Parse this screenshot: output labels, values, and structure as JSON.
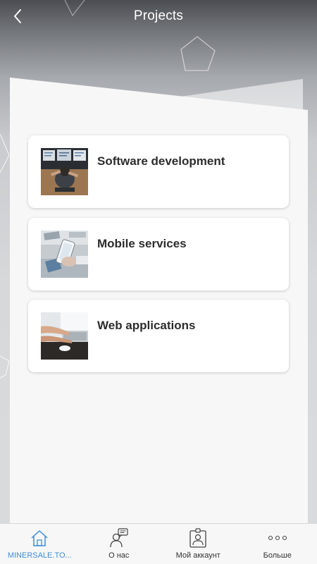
{
  "header": {
    "title": "Projects",
    "back_icon": "chevron-left-icon"
  },
  "projects": [
    {
      "title": "Software development",
      "thumb_icon": "developer-desk-photo"
    },
    {
      "title": "Mobile services",
      "thumb_icon": "smartphone-photo"
    },
    {
      "title": "Web applications",
      "thumb_icon": "laptop-typing-photo"
    }
  ],
  "tabbar": {
    "tabs": [
      {
        "label": "MINERSALE.TO...",
        "icon": "home-icon",
        "active": true
      },
      {
        "label": "О нас",
        "icon": "person-chat-icon",
        "active": false
      },
      {
        "label": "Мой аккаунт",
        "icon": "account-badge-icon",
        "active": false
      },
      {
        "label": "Больше",
        "icon": "more-dots-icon",
        "active": false
      }
    ]
  },
  "colors": {
    "accent": "#3d8ed9",
    "card_title": "#2d2d2d",
    "header_text": "#ffffff"
  }
}
